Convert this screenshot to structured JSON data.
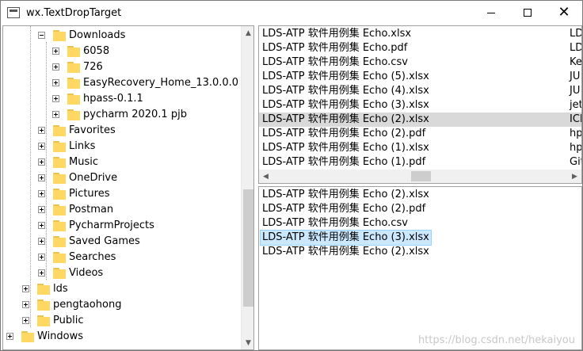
{
  "window": {
    "title": "wx.TextDropTarget"
  },
  "tree": {
    "items": [
      {
        "label": "Downloads",
        "level": 2,
        "expander": "minus"
      },
      {
        "label": "6058",
        "level": 3,
        "expander": "plus"
      },
      {
        "label": "726",
        "level": 3,
        "expander": "plus"
      },
      {
        "label": "EasyRecovery_Home_13.0.0.0",
        "level": 3,
        "expander": "plus"
      },
      {
        "label": "hpass-0.1.1",
        "level": 3,
        "expander": "plus"
      },
      {
        "label": "pycharm 2020.1 pjb",
        "level": 3,
        "expander": "plus"
      },
      {
        "label": "Favorites",
        "level": 2,
        "expander": "plus"
      },
      {
        "label": "Links",
        "level": 2,
        "expander": "plus"
      },
      {
        "label": "Music",
        "level": 2,
        "expander": "plus"
      },
      {
        "label": "OneDrive",
        "level": 2,
        "expander": "plus"
      },
      {
        "label": "Pictures",
        "level": 2,
        "expander": "plus"
      },
      {
        "label": "Postman",
        "level": 2,
        "expander": "plus"
      },
      {
        "label": "PycharmProjects",
        "level": 2,
        "expander": "plus"
      },
      {
        "label": "Saved Games",
        "level": 2,
        "expander": "plus"
      },
      {
        "label": "Searches",
        "level": 2,
        "expander": "plus"
      },
      {
        "label": "Videos",
        "level": 2,
        "expander": "plus"
      },
      {
        "label": "lds",
        "level": 1,
        "expander": "plus"
      },
      {
        "label": "pengtaohong",
        "level": 1,
        "expander": "plus"
      },
      {
        "label": "Public",
        "level": 1,
        "expander": "plus"
      },
      {
        "label": "Windows",
        "level": 0,
        "expander": "plus"
      }
    ]
  },
  "top_list": {
    "rows": [
      {
        "name": "LDS-ATP  软件用例集 Echo.xlsx",
        "col2": "LD"
      },
      {
        "name": "LDS-ATP  软件用例集 Echo.pdf",
        "col2": "LD"
      },
      {
        "name": "LDS-ATP  软件用例集 Echo.csv",
        "col2": "Ke"
      },
      {
        "name": "LDS-ATP  软件用例集 Echo (5).xlsx",
        "col2": "JU"
      },
      {
        "name": "LDS-ATP  软件用例集 Echo (4).xlsx",
        "col2": "JU"
      },
      {
        "name": "LDS-ATP  软件用例集 Echo (3).xlsx",
        "col2": "jet"
      },
      {
        "name": "LDS-ATP  软件用例集 Echo (2).xlsx",
        "col2": "ICE",
        "selected": true
      },
      {
        "name": "LDS-ATP  软件用例集 Echo (2).pdf",
        "col2": "hp"
      },
      {
        "name": "LDS-ATP  软件用例集 Echo (1).xlsx",
        "col2": "hp"
      },
      {
        "name": "LDS-ATP  软件用例集 Echo (1).pdf",
        "col2": "Git"
      }
    ]
  },
  "bottom_list": {
    "rows": [
      {
        "name": "LDS-ATP  软件用例集 Echo (2).xlsx"
      },
      {
        "name": "LDS-ATP  软件用例集 Echo (2).pdf"
      },
      {
        "name": "LDS-ATP  软件用例集 Echo.csv"
      },
      {
        "name": "LDS-ATP  软件用例集 Echo (3).xlsx",
        "focused": true
      },
      {
        "name": "LDS-ATP  软件用例集 Echo (2).xlsx"
      }
    ]
  },
  "watermark": "https://blog.csdn.net/hekaiyou"
}
